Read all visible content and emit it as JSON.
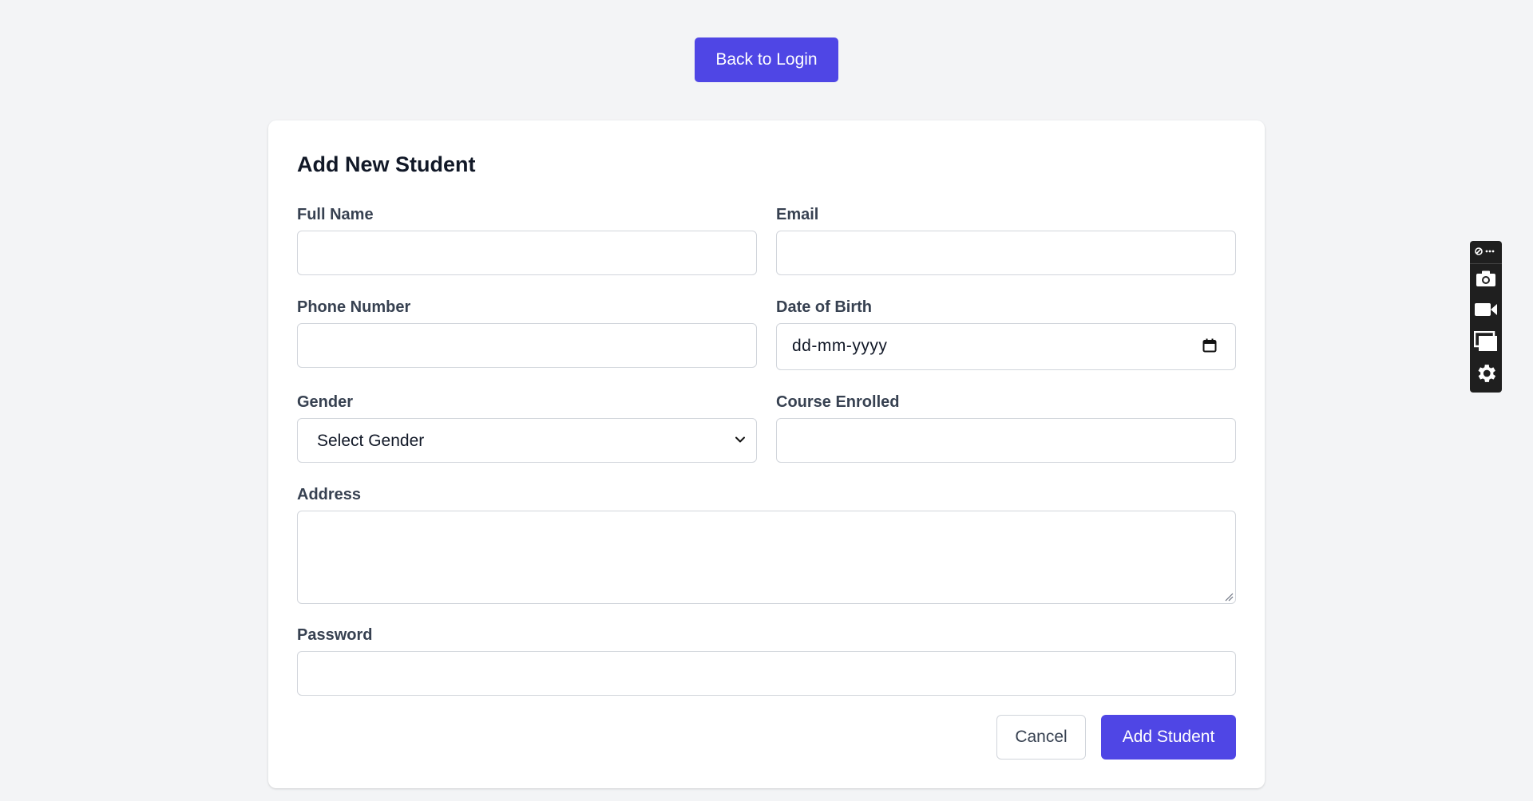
{
  "header": {
    "back_label": "Back to Login"
  },
  "form": {
    "title": "Add New Student",
    "fields": {
      "full_name": {
        "label": "Full Name",
        "value": ""
      },
      "email": {
        "label": "Email",
        "value": ""
      },
      "phone": {
        "label": "Phone Number",
        "value": ""
      },
      "dob": {
        "label": "Date of Birth",
        "value": "dd-mm-yyyy"
      },
      "gender": {
        "label": "Gender",
        "selected": "Select Gender"
      },
      "course": {
        "label": "Course Enrolled",
        "value": ""
      },
      "address": {
        "label": "Address",
        "value": ""
      },
      "password": {
        "label": "Password",
        "value": ""
      }
    },
    "actions": {
      "cancel_label": "Cancel",
      "submit_label": "Add Student"
    }
  },
  "toolbar": {
    "icons": [
      "extension-menu-icon",
      "camera-icon",
      "video-camera-icon",
      "window-capture-icon",
      "settings-icon"
    ]
  },
  "colors": {
    "primary": "#4f46e5",
    "page_bg": "#f3f4f6",
    "card_bg": "#ffffff",
    "border": "#d1d5db",
    "label_text": "#374151"
  }
}
